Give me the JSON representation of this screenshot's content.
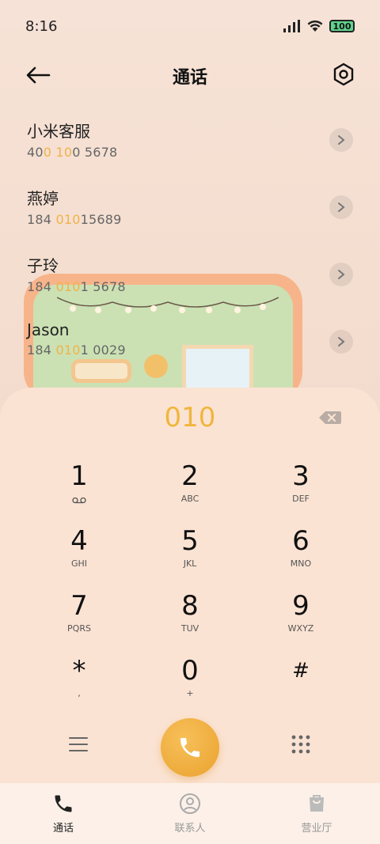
{
  "status_bar": {
    "time": "8:16",
    "battery": "100"
  },
  "header": {
    "title": "通话"
  },
  "contacts": [
    {
      "name": "小米客服",
      "number_parts": [
        "40",
        "0",
        " ",
        "10",
        "0 5678"
      ]
    },
    {
      "name": "燕婷",
      "number_parts": [
        "184 ",
        "010",
        "15689",
        "",
        ""
      ]
    },
    {
      "name": "子玲",
      "number_parts": [
        "184 ",
        "010",
        "1 5678",
        "",
        ""
      ]
    },
    {
      "name": "Jason",
      "number_parts": [
        "184 ",
        "010",
        "1 0029",
        "",
        ""
      ]
    }
  ],
  "dialer": {
    "input": "010",
    "keys": [
      {
        "digit": "1",
        "letters": ""
      },
      {
        "digit": "2",
        "letters": "ABC"
      },
      {
        "digit": "3",
        "letters": "DEF"
      },
      {
        "digit": "4",
        "letters": "GHI"
      },
      {
        "digit": "5",
        "letters": "JKL"
      },
      {
        "digit": "6",
        "letters": "MNO"
      },
      {
        "digit": "7",
        "letters": "PQRS"
      },
      {
        "digit": "8",
        "letters": "TUV"
      },
      {
        "digit": "9",
        "letters": "WXYZ"
      },
      {
        "digit": "*",
        "letters": ","
      },
      {
        "digit": "0",
        "letters": "+"
      },
      {
        "digit": "#",
        "letters": ""
      }
    ]
  },
  "bottom_nav": {
    "calls": "通话",
    "contacts": "联系人",
    "service": "营业厅"
  },
  "colors": {
    "accent": "#f1b53c",
    "highlight": "#f0b24a",
    "call_button": "#eaa22e"
  }
}
